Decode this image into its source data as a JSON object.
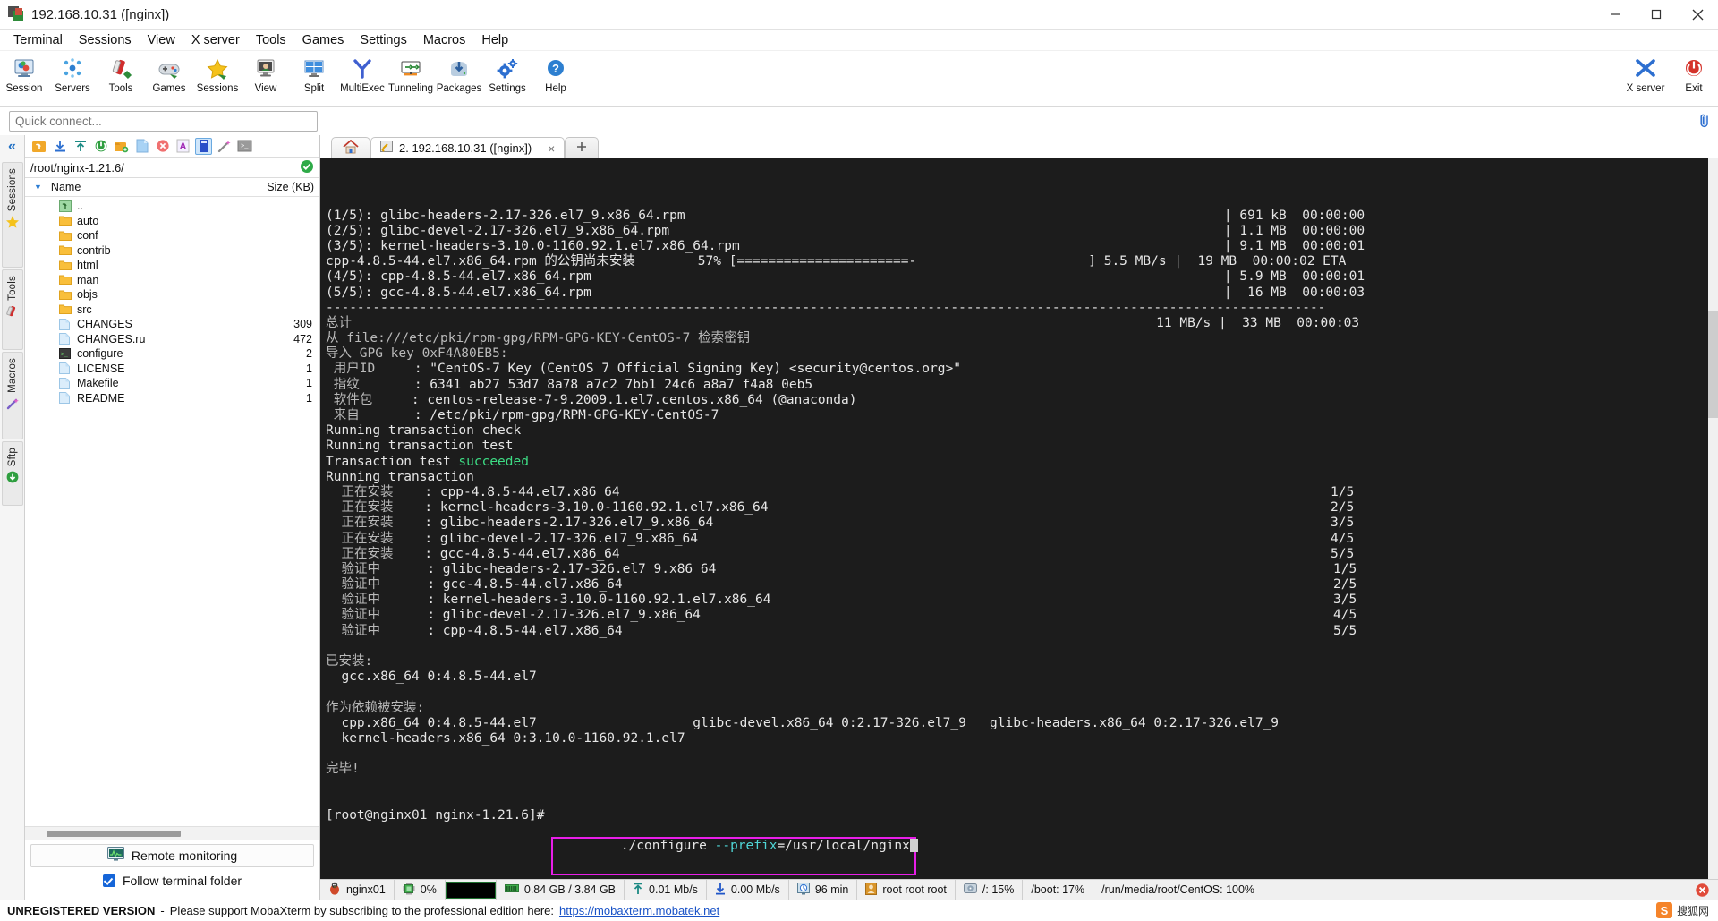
{
  "window": {
    "title": "192.168.10.31 ([nginx])",
    "minimize_label": "minimize",
    "maximize_label": "restore",
    "close_label": "close"
  },
  "menubar": {
    "items": [
      "Terminal",
      "Sessions",
      "View",
      "X server",
      "Tools",
      "Games",
      "Settings",
      "Macros",
      "Help"
    ]
  },
  "toolbar": {
    "items": [
      {
        "label": "Session",
        "icon": "session-icon"
      },
      {
        "label": "Servers",
        "icon": "servers-icon"
      },
      {
        "label": "Tools",
        "icon": "tools-icon"
      },
      {
        "label": "Games",
        "icon": "games-icon"
      },
      {
        "label": "Sessions",
        "icon": "star-icon"
      },
      {
        "label": "View",
        "icon": "view-icon"
      },
      {
        "label": "Split",
        "icon": "split-icon"
      },
      {
        "label": "MultiExec",
        "icon": "multiexec-icon"
      },
      {
        "label": "Tunneling",
        "icon": "tunneling-icon"
      },
      {
        "label": "Packages",
        "icon": "packages-icon"
      },
      {
        "label": "Settings",
        "icon": "settings-icon"
      },
      {
        "label": "Help",
        "icon": "help-icon"
      }
    ],
    "right_items": [
      {
        "label": "X server",
        "icon": "xserver-icon"
      },
      {
        "label": "Exit",
        "icon": "exit-icon"
      }
    ]
  },
  "quick_connect": {
    "placeholder": "Quick connect..."
  },
  "rail": {
    "collapse_label": "«",
    "tabs": [
      "Sessions",
      "Tools",
      "Macros",
      "Sftp"
    ]
  },
  "file_panel": {
    "path": "/root/nginx-1.21.6/",
    "columns": {
      "name": "Name",
      "size": "Size (KB)"
    },
    "rows": [
      {
        "name": "..",
        "size": "",
        "type": "parent"
      },
      {
        "name": "auto",
        "size": "",
        "type": "folder"
      },
      {
        "name": "conf",
        "size": "",
        "type": "folder"
      },
      {
        "name": "contrib",
        "size": "",
        "type": "folder"
      },
      {
        "name": "html",
        "size": "",
        "type": "folder"
      },
      {
        "name": "man",
        "size": "",
        "type": "folder"
      },
      {
        "name": "objs",
        "size": "",
        "type": "folder"
      },
      {
        "name": "src",
        "size": "",
        "type": "folder"
      },
      {
        "name": "CHANGES",
        "size": "309",
        "type": "file"
      },
      {
        "name": "CHANGES.ru",
        "size": "472",
        "type": "file"
      },
      {
        "name": "configure",
        "size": "2",
        "type": "script"
      },
      {
        "name": "LICENSE",
        "size": "1",
        "type": "file"
      },
      {
        "name": "Makefile",
        "size": "1",
        "type": "file"
      },
      {
        "name": "README",
        "size": "1",
        "type": "file"
      }
    ],
    "remote_monitoring": "Remote monitoring",
    "follow_terminal_folder": "Follow terminal folder",
    "follow_checked": true
  },
  "tabs": {
    "home_label": "home",
    "session_label": "2. 192.168.10.31 ([nginx])",
    "close_label": "×",
    "new_tab_label": "+"
  },
  "terminal": {
    "lines": [
      {
        "text": "(1/5): glibc-headers-2.17-326.el7_9.x86_64.rpm",
        "right": "| 691 kB  00:00:00"
      },
      {
        "text": "(2/5): glibc-devel-2.17-326.el7_9.x86_64.rpm",
        "right": "| 1.1 MB  00:00:00"
      },
      {
        "text": "(3/5): kernel-headers-3.10.0-1160.92.1.el7.x86_64.rpm",
        "right": "| 9.1 MB  00:00:01"
      },
      {
        "text": "cpp-4.8.5-44.el7.x86_64.rpm 的公钥尚未安装        57% [======================-                      ] 5.5 MB/s",
        "right": "|  19 MB  00:00:02 ETA"
      },
      {
        "text": "(4/5): cpp-4.8.5-44.el7.x86_64.rpm",
        "right": "| 5.9 MB  00:00:01"
      },
      {
        "text": "(5/5): gcc-4.8.5-44.el7.x86_64.rpm",
        "right": "|  16 MB  00:00:03"
      },
      {
        "text": "--------------------------------------------------------------------------------------------------------------------------------",
        "right": ""
      },
      {
        "text": "总计",
        "right": "11 MB/s |  33 MB  00:00:03"
      },
      {
        "text": "从 file:///etc/pki/rpm-gpg/RPM-GPG-KEY-CentOS-7 检索密钥",
        "right": ""
      },
      {
        "text": "导入 GPG key 0xF4A80EB5:",
        "right": ""
      },
      {
        "text": " 用户ID     : \"CentOS-7 Key (CentOS 7 Official Signing Key) <security@centos.org>\"",
        "right": ""
      },
      {
        "text": " 指纹       : 6341 ab27 53d7 8a78 a7c2 7bb1 24c6 a8a7 f4a8 0eb5",
        "right": ""
      },
      {
        "text": " 软件包     : centos-release-7-9.2009.1.el7.centos.x86_64 (@anaconda)",
        "right": ""
      },
      {
        "text": " 来自       : /etc/pki/rpm-gpg/RPM-GPG-KEY-CentOS-7",
        "right": ""
      },
      {
        "text": "Running transaction check",
        "right": ""
      },
      {
        "text": "Running transaction test",
        "right": ""
      },
      {
        "text": "Transaction test succeeded",
        "right": "",
        "green_word": "succeeded"
      },
      {
        "text": "Running transaction",
        "right": ""
      },
      {
        "text": "  正在安装    : cpp-4.8.5-44.el7.x86_64",
        "right": "1/5"
      },
      {
        "text": "  正在安装    : kernel-headers-3.10.0-1160.92.1.el7.x86_64",
        "right": "2/5"
      },
      {
        "text": "  正在安装    : glibc-headers-2.17-326.el7_9.x86_64",
        "right": "3/5"
      },
      {
        "text": "  正在安装    : glibc-devel-2.17-326.el7_9.x86_64",
        "right": "4/5"
      },
      {
        "text": "  正在安装    : gcc-4.8.5-44.el7.x86_64",
        "right": "5/5"
      },
      {
        "text": "  验证中      : glibc-headers-2.17-326.el7_9.x86_64",
        "right": "1/5"
      },
      {
        "text": "  验证中      : gcc-4.8.5-44.el7.x86_64",
        "right": "2/5"
      },
      {
        "text": "  验证中      : kernel-headers-3.10.0-1160.92.1.el7.x86_64",
        "right": "3/5"
      },
      {
        "text": "  验证中      : glibc-devel-2.17-326.el7_9.x86_64",
        "right": "4/5"
      },
      {
        "text": "  验证中      : cpp-4.8.5-44.el7.x86_64",
        "right": "5/5"
      },
      {
        "text": "",
        "right": ""
      },
      {
        "text": "已安装:",
        "right": ""
      },
      {
        "text": "  gcc.x86_64 0:4.8.5-44.el7",
        "right": ""
      },
      {
        "text": "",
        "right": ""
      },
      {
        "text": "作为依赖被安装:",
        "right": ""
      },
      {
        "text": "  cpp.x86_64 0:4.8.5-44.el7                    glibc-devel.x86_64 0:2.17-326.el7_9   glibc-headers.x86_64 0:2.17-326.el7_9",
        "right": ""
      },
      {
        "text": "  kernel-headers.x86_64 0:3.10.0-1160.92.1.el7",
        "right": ""
      },
      {
        "text": "",
        "right": ""
      },
      {
        "text": "完毕!",
        "right": ""
      }
    ],
    "prompt": "[root@nginx01 nginx-1.21.6]# ",
    "command_prefix": "./configure ",
    "command_flag": "--prefix",
    "command_suffix": "=/usr/local/nginx",
    "highlight_color": "#e81ee8"
  },
  "statusbar": {
    "host": "nginx01",
    "cpu": "0%",
    "memory": "0.84 GB / 3.84 GB",
    "upload": "0.01 Mb/s",
    "download": "0.00 Mb/s",
    "uptime": "96 min",
    "user": "root root root",
    "disk_root": "/: 15%",
    "disk_boot": "/boot: 17%",
    "disk_media": "/run/media/root/CentOS: 100%"
  },
  "footer": {
    "unregistered": "UNREGISTERED VERSION",
    "separator": "-",
    "message": "Please support MobaXterm by subscribing to the professional edition here:",
    "link": "https://mobaxterm.mobatek.net",
    "watermark": "搜狐网"
  }
}
